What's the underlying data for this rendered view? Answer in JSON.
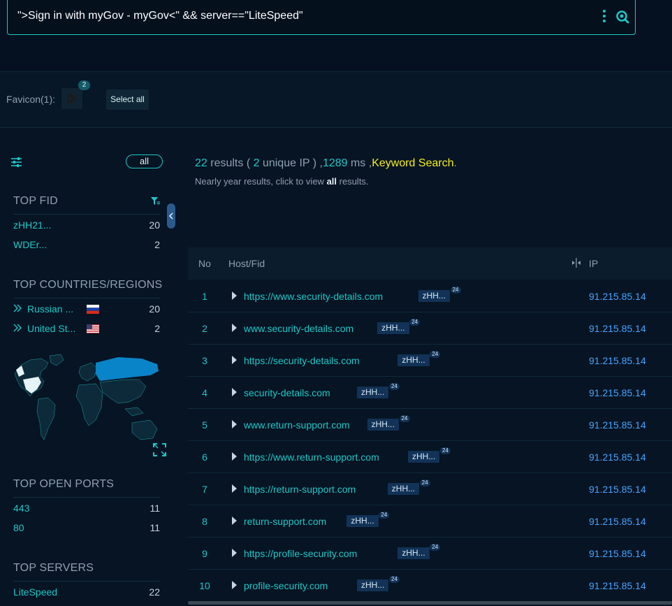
{
  "search": {
    "query": "\">Sign in with myGov - myGov<\" && server==\"LiteSpeed\""
  },
  "favicon": {
    "label": "Favicon(1):",
    "count": "2",
    "select_all": "Select all"
  },
  "sidebar": {
    "all_label": "all",
    "top_fid": {
      "title": "TOP FID",
      "items": [
        {
          "label": "zHH21...",
          "count": "20"
        },
        {
          "label": "WDEr...",
          "count": "2"
        }
      ]
    },
    "top_countries": {
      "title": "TOP COUNTRIES/REGIONS",
      "items": [
        {
          "label": "Russian ...",
          "count": "20",
          "flag": "ru"
        },
        {
          "label": "United St...",
          "count": "2",
          "flag": "us"
        }
      ]
    },
    "top_ports": {
      "title": "TOP OPEN PORTS",
      "items": [
        {
          "label": "443",
          "count": "11"
        },
        {
          "label": "80",
          "count": "11"
        }
      ]
    },
    "top_servers": {
      "title": "TOP SERVERS",
      "items": [
        {
          "label": "LiteSpeed",
          "count": "22"
        }
      ]
    }
  },
  "summary": {
    "results_num": "22",
    "results_word": " results ( ",
    "unique_num": "2",
    "unique_word": " unique IP ) ,",
    "ms_num": "1289",
    "ms_word": " ms ,",
    "keyword": "Keyword Search",
    "period": ".",
    "note_prefix": "Nearly year results, click to view ",
    "note_all": "all",
    "note_suffix": " results."
  },
  "table": {
    "headers": {
      "no": "No",
      "host": "Host/Fid",
      "ip": "IP"
    },
    "rows": [
      {
        "no": "1",
        "host": "https://www.security-details.com",
        "fid": "zHH...",
        "sup": "24",
        "ip": "91.215.85.14"
      },
      {
        "no": "2",
        "host": "www.security-details.com",
        "fid": "zHH...",
        "sup": "24",
        "ip": "91.215.85.14"
      },
      {
        "no": "3",
        "host": "https://security-details.com",
        "fid": "zHH...",
        "sup": "24",
        "ip": "91.215.85.14"
      },
      {
        "no": "4",
        "host": "security-details.com",
        "fid": "zHH...",
        "sup": "24",
        "ip": "91.215.85.14"
      },
      {
        "no": "5",
        "host": "www.return-support.com",
        "fid": "zHH...",
        "sup": "24",
        "ip": "91.215.85.14"
      },
      {
        "no": "6",
        "host": "https://www.return-support.com",
        "fid": "zHH...",
        "sup": "24",
        "ip": "91.215.85.14"
      },
      {
        "no": "7",
        "host": "https://return-support.com",
        "fid": "zHH...",
        "sup": "24",
        "ip": "91.215.85.14"
      },
      {
        "no": "8",
        "host": "return-support.com",
        "fid": "zHH...",
        "sup": "24",
        "ip": "91.215.85.14"
      },
      {
        "no": "9",
        "host": "https://profile-security.com",
        "fid": "zHH...",
        "sup": "24",
        "ip": "91.215.85.14"
      },
      {
        "no": "10",
        "host": "profile-security.com",
        "fid": "zHH...",
        "sup": "24",
        "ip": "91.215.85.14"
      }
    ]
  },
  "colors": {
    "accent": "#1ec8c8",
    "ip": "#4aa3ff",
    "keyword": "#f5f016",
    "background": "#061423"
  }
}
